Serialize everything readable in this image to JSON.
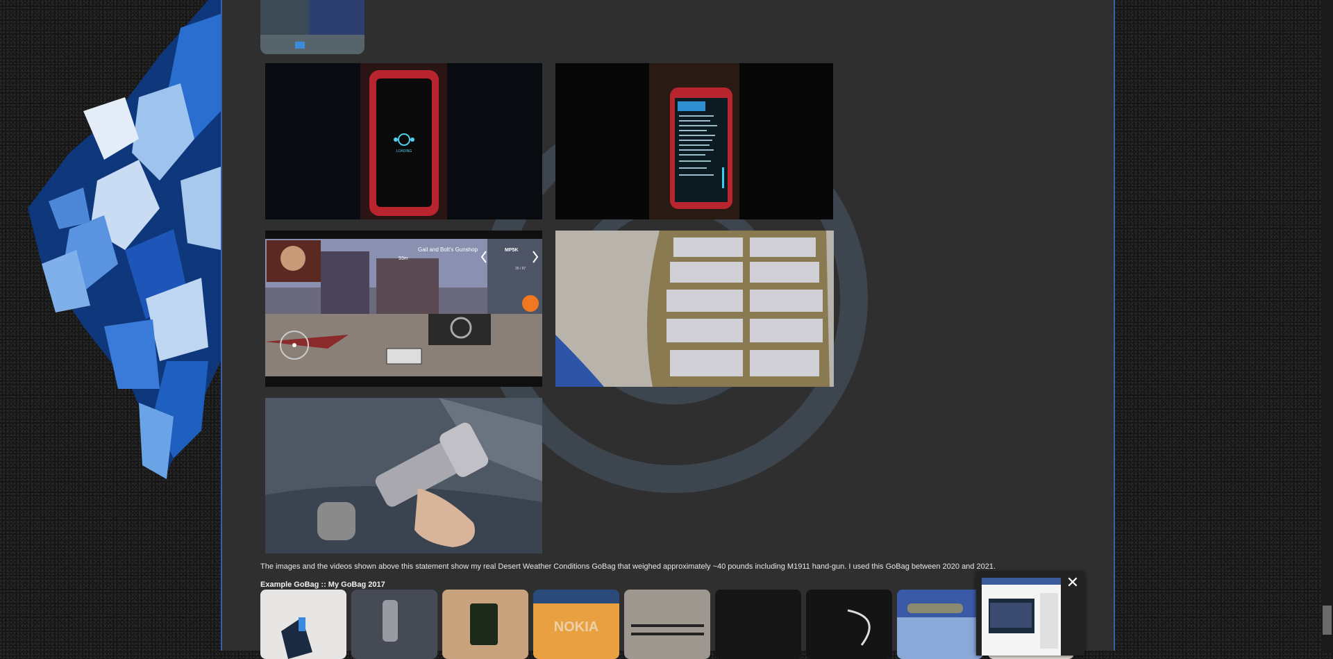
{
  "caption": "The images and the videos shown above this statement show my real Desert Weather Conditions GoBag that weighed approximately ~40 pounds including M1911 hand-gun. I used this GoBag between 2020 and 2021.",
  "gallery_title": "Example GoBag :: My GoBag 2017",
  "game_hud": {
    "shop_label": "Gail and Bolt's Gunshop",
    "weapon_label": "MP5K",
    "distance_label": "93m",
    "ammo_label": "35 / 87"
  },
  "phone_boot_label": "LOADING",
  "strip_watermark": "NOKIA",
  "popup": {
    "close_label": "✕"
  },
  "colors": {
    "accent_border": "#3a5ea8",
    "panel_bg": "#2f2f2f"
  }
}
